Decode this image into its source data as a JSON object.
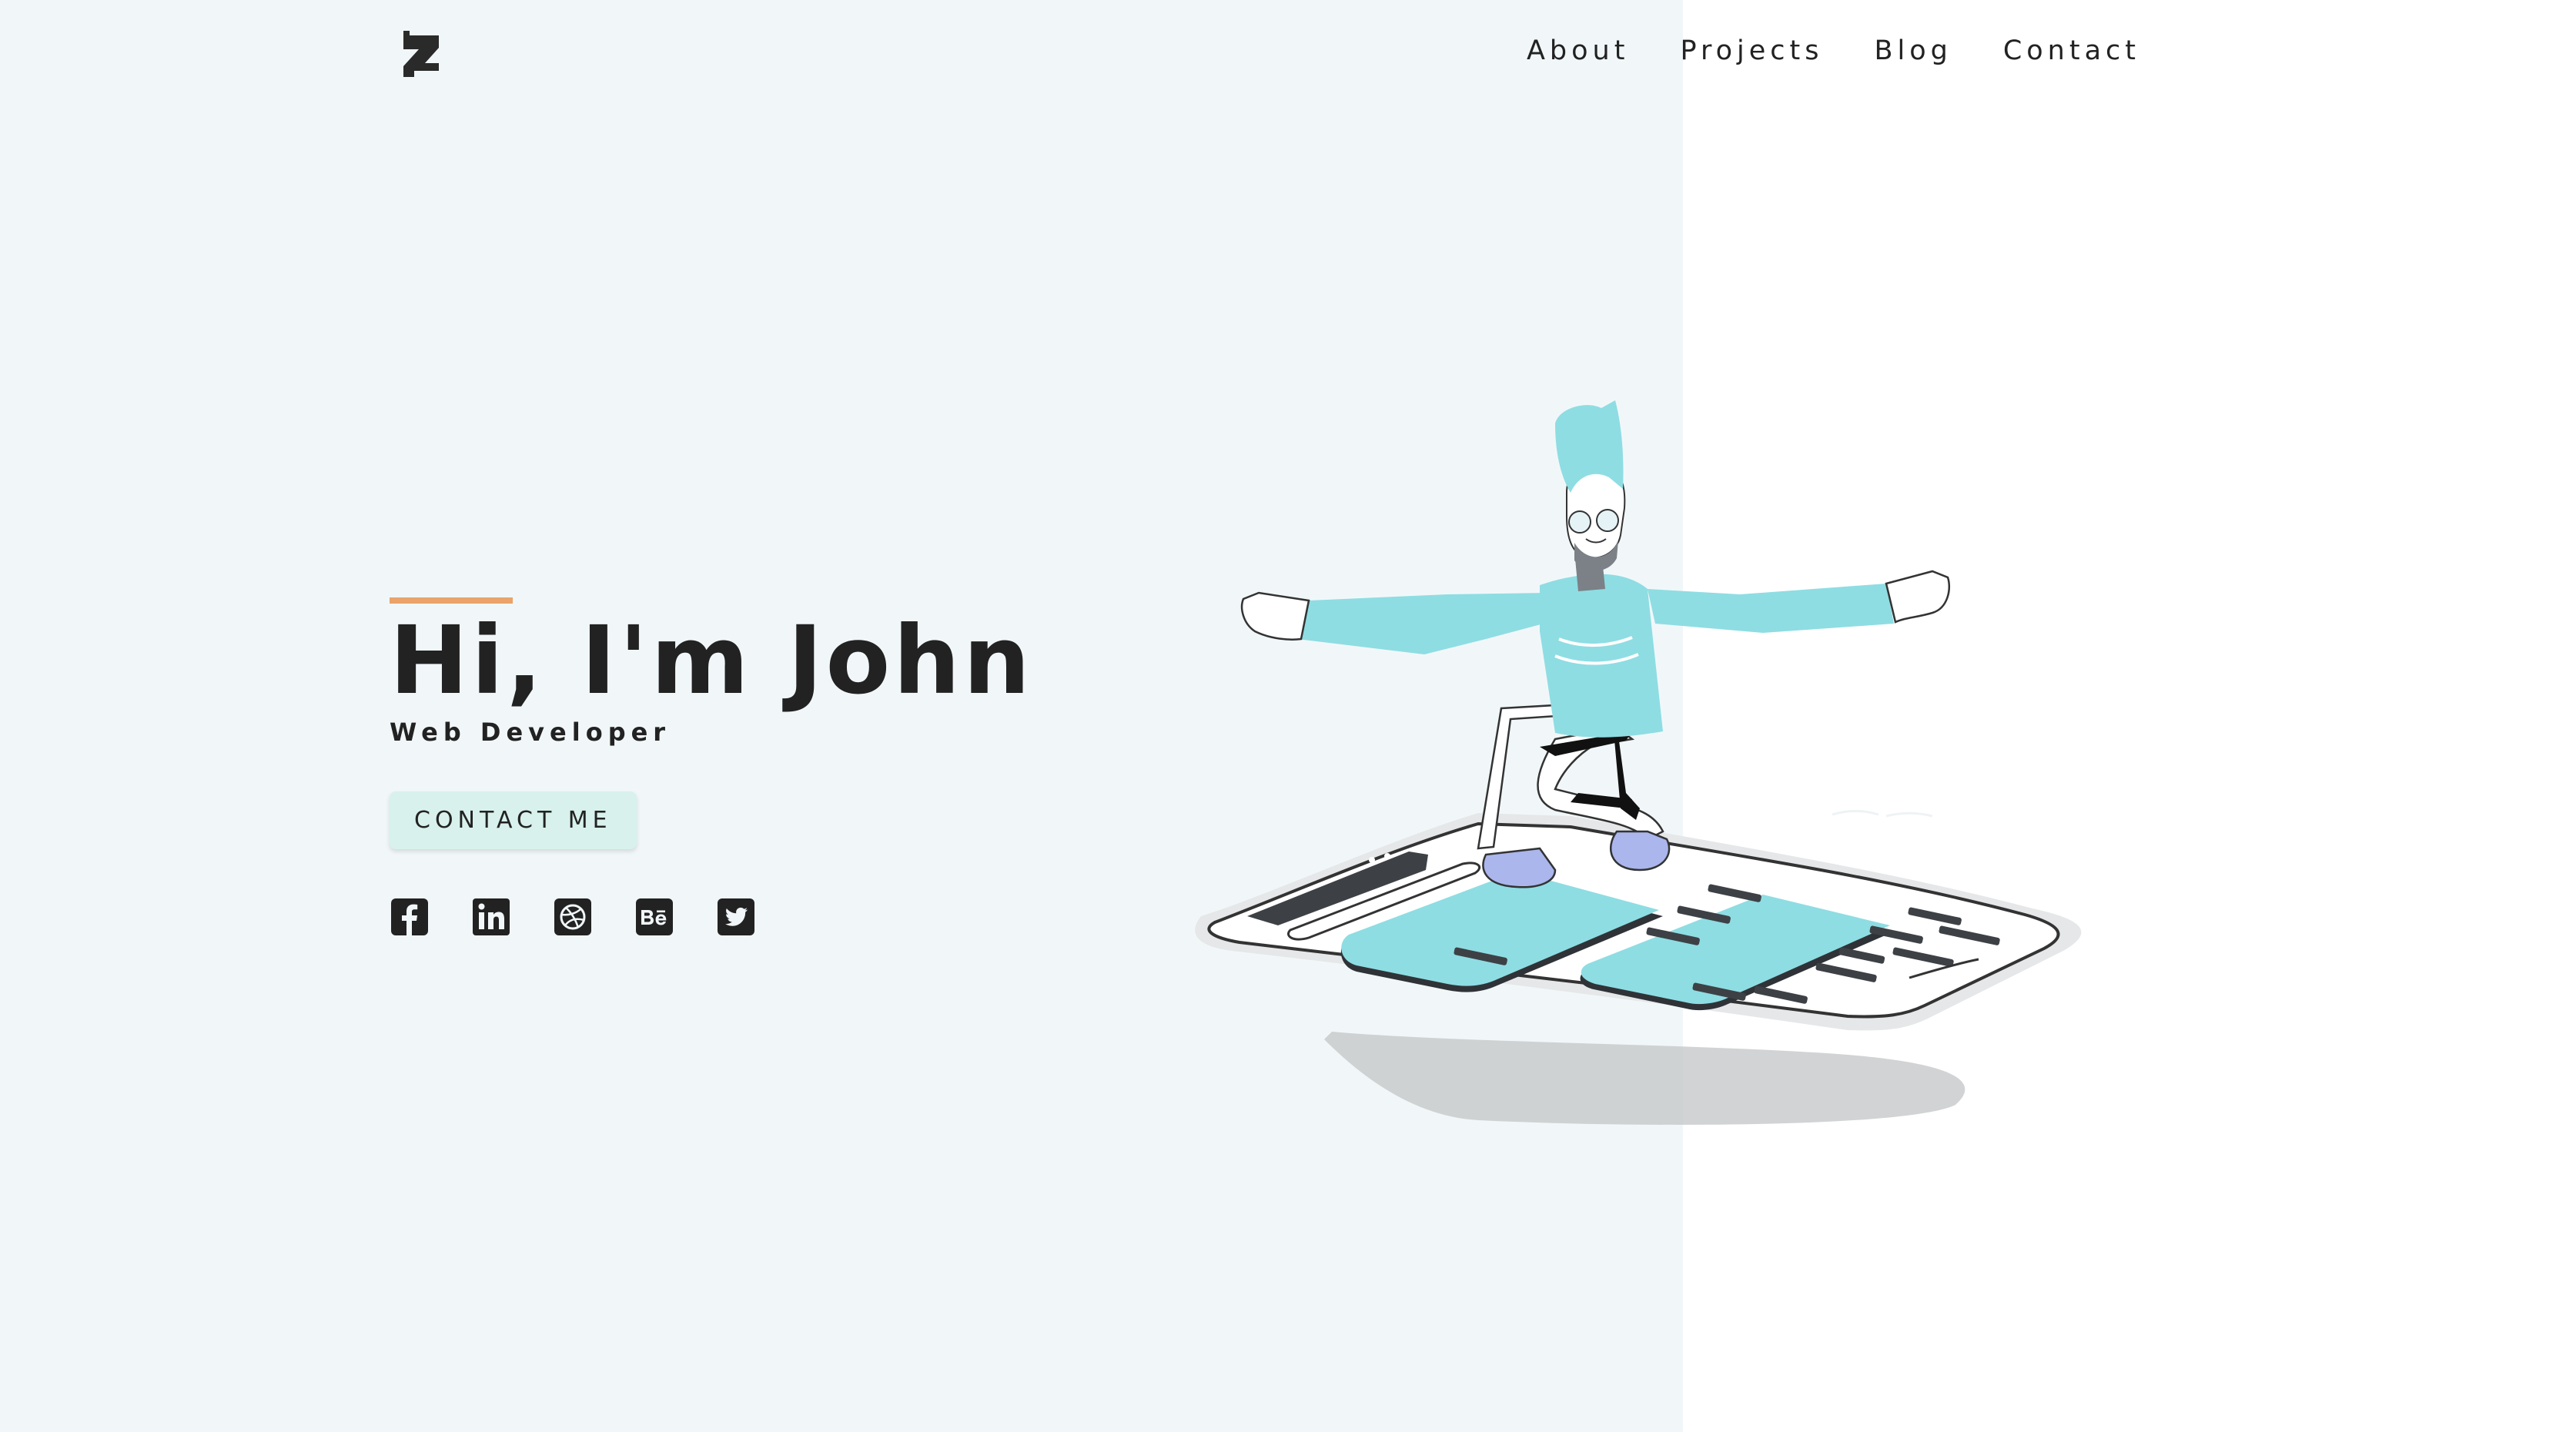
{
  "nav": {
    "items": [
      {
        "label": "About"
      },
      {
        "label": "Projects"
      },
      {
        "label": "Blog"
      },
      {
        "label": "Contact"
      }
    ]
  },
  "hero": {
    "title": "Hi, I'm John",
    "subtitle": "Web Developer",
    "cta_label": "CONTACT ME"
  },
  "socials": [
    {
      "icon": "facebook-icon"
    },
    {
      "icon": "linkedin-icon"
    },
    {
      "icon": "dribbble-icon"
    },
    {
      "icon": "behance-icon"
    },
    {
      "icon": "twitter-icon"
    }
  ],
  "colors": {
    "left_background": "#f1f7f9",
    "accent_line": "#e9a36b",
    "button_background": "#d8f1ec",
    "illustration_cyan": "#8edde3",
    "text": "#222222"
  }
}
